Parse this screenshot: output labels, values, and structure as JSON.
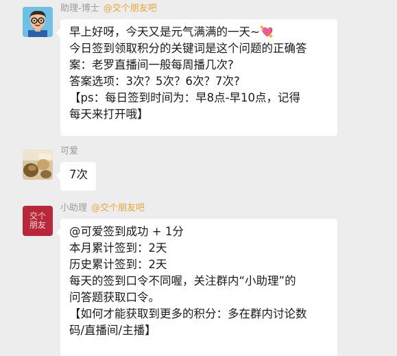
{
  "messages": [
    {
      "sender": "助理-博士",
      "tag": "@交个朋友吧",
      "avatar_icon": "cartoon-man-glasses-icon",
      "lines": [
        "早上好呀，今天又是元气满满的一天~",
        "今日签到领取积分的关键词是这个问题的正确答",
        "案：老罗直播间一般每周播几次?",
        "答案选项：3次？5次？6次？7次?",
        "【ps：每日签到时间为：早8点-早10点，记得",
        "每天来打开哦】"
      ],
      "emoji": "💘"
    },
    {
      "sender": "可爱",
      "tag": "",
      "avatar_icon": "food-photo-icon",
      "lines": [
        "7次"
      ]
    },
    {
      "sender": "小助理",
      "tag": "@交个朋友吧",
      "avatar_icon": "brand-logo-icon",
      "avatar_text": "交个朋友",
      "lines": [
        "@可爱签到成功 + 1分",
        "本月累计签到：2天",
        "历史累计签到：2天",
        "每天的签到口令不同喔，关注群内“小助理”的",
        "问答题获取口令。",
        "【如何才能获取到更多的积分：多在群内讨论数",
        "码/直播间/主播】"
      ]
    }
  ],
  "colors": {
    "background": "#ededed",
    "bubble": "#ffffff",
    "nickname": "#9a9a9a",
    "tag": "#e8a53c",
    "logo_red": "#b8283a"
  }
}
